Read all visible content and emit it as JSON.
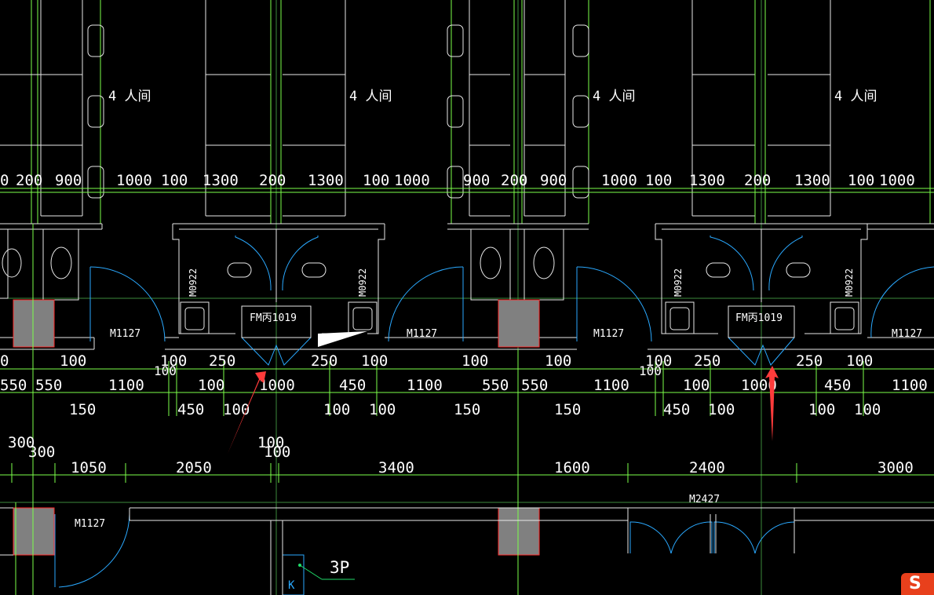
{
  "drawing": {
    "room_label": "4 人间",
    "dims_row1": [
      "0",
      "200",
      "900",
      "1000",
      "100",
      "1300",
      "200",
      "1300",
      "100",
      "1000",
      "900",
      "200",
      "900",
      "1000",
      "100",
      "1300",
      "200",
      "1300",
      "100",
      "1000"
    ],
    "dims_row2a": [
      "0",
      "100",
      "100",
      "250",
      "250",
      "100",
      "100",
      "100",
      "100",
      "250",
      "250",
      "100"
    ],
    "dims_row2b": [
      "100",
      "100"
    ],
    "dims_row3": [
      "550",
      "550",
      "1100",
      "100",
      "1000",
      "450",
      "1100",
      "550",
      "550",
      "1100",
      "100",
      "1000",
      "450",
      "1100"
    ],
    "dims_row4": [
      "150",
      "450",
      "100",
      "100",
      "100",
      "150",
      "150",
      "450",
      "100",
      "100",
      "100"
    ],
    "dims_row5": [
      "300",
      "300",
      "1050",
      "2050",
      "100",
      "100",
      "3400",
      "1600",
      "2400",
      "3000"
    ],
    "door_m0922": "M0922",
    "door_m1127": "M1127",
    "door_fm": "FM丙1019",
    "door_m2427": "M2427",
    "label_3p": "3P",
    "label_k": "K",
    "ime_logo": "S"
  },
  "colors": {
    "background": "#000000",
    "wall": "#e8e8e8",
    "dimension": "#7cff4a",
    "door_swing": "#2aa9ff",
    "column_fill": "#808080",
    "column_outline": "#ff2a2a",
    "annotation_arrow": "#ff3b3b"
  }
}
